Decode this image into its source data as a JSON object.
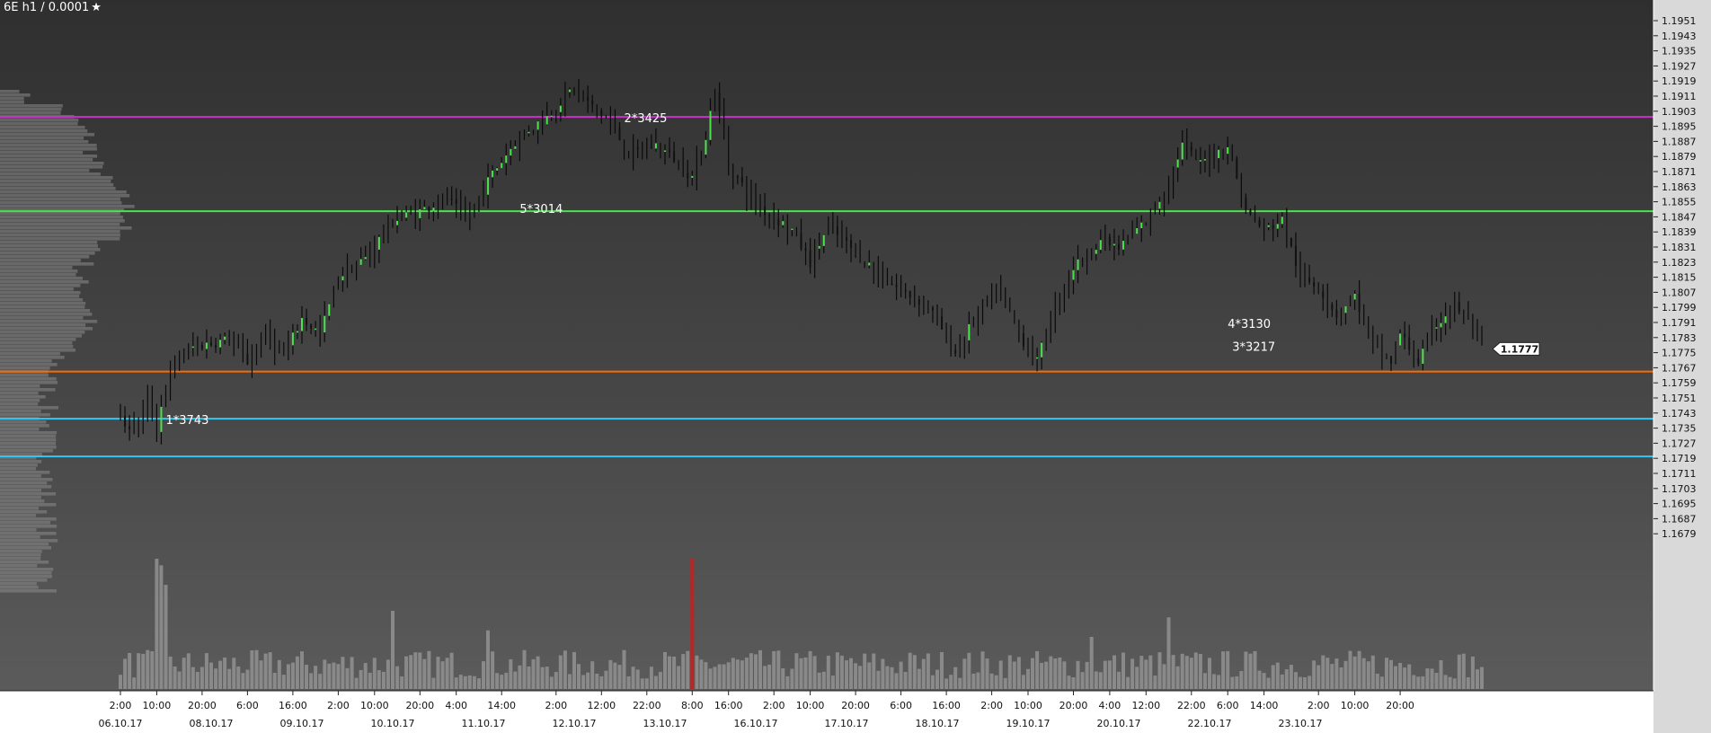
{
  "title": "6E h1 / 0.0001",
  "title_icon": "star-icon",
  "colors": {
    "magenta": "#c832c8",
    "green": "#4ce24c",
    "orange": "#ff6a00",
    "cyan": "#35c8f0",
    "red_spike": "#c81e1e"
  },
  "price_axis": {
    "min": 1.1675,
    "max": 1.1955,
    "ticks": [
      "1.1951",
      "1.1943",
      "1.1935",
      "1.1927",
      "1.1919",
      "1.1911",
      "1.1903",
      "1.1895",
      "1.1887",
      "1.1879",
      "1.1871",
      "1.1863",
      "1.1855",
      "1.1847",
      "1.1839",
      "1.1831",
      "1.1823",
      "1.1815",
      "1.1807",
      "1.1799",
      "1.1791",
      "1.1783",
      "1.1775",
      "1.1767",
      "1.1759",
      "1.1751",
      "1.1743",
      "1.1735",
      "1.1727",
      "1.1719",
      "1.1711",
      "1.1703",
      "1.1695",
      "1.1687",
      "1.1679"
    ]
  },
  "levels": [
    {
      "price": 1.19,
      "label": "1.1900",
      "color": "#c832c8"
    },
    {
      "price": 1.185,
      "label": "1.1850",
      "color": "#4ce24c"
    },
    {
      "price": 1.1765,
      "label": "1.1765",
      "color": "#ff6a00"
    },
    {
      "price": 1.174,
      "label": "1.1740",
      "color": "#35c8f0"
    },
    {
      "price": 1.172,
      "label": "1.1720",
      "color": "#35c8f0"
    }
  ],
  "current_price": {
    "price": 1.1777,
    "label": "1.1777"
  },
  "annotations": [
    {
      "text": "1*3743",
      "bar": 10,
      "price": 1.1739
    },
    {
      "text": "2*3425",
      "bar": 111,
      "price": 1.1899
    },
    {
      "text": "5*3014",
      "bar": 88,
      "price": 1.1851
    },
    {
      "text": "4*3130",
      "bar": 244,
      "price": 1.179
    },
    {
      "text": "3*3217",
      "bar": 245,
      "price": 1.1778
    }
  ],
  "time_axis": {
    "times": [
      {
        "label": "2:00",
        "bar": 0
      },
      {
        "label": "10:00",
        "bar": 8
      },
      {
        "label": "20:00",
        "bar": 18
      },
      {
        "label": "6:00",
        "bar": 28
      },
      {
        "label": "16:00",
        "bar": 38
      },
      {
        "label": "2:00",
        "bar": 48
      },
      {
        "label": "10:00",
        "bar": 56
      },
      {
        "label": "20:00",
        "bar": 66
      },
      {
        "label": "4:00",
        "bar": 74
      },
      {
        "label": "14:00",
        "bar": 84
      },
      {
        "label": "2:00",
        "bar": 96
      },
      {
        "label": "12:00",
        "bar": 106
      },
      {
        "label": "22:00",
        "bar": 116
      },
      {
        "label": "8:00",
        "bar": 126
      },
      {
        "label": "16:00",
        "bar": 134
      },
      {
        "label": "2:00",
        "bar": 144
      },
      {
        "label": "10:00",
        "bar": 152
      },
      {
        "label": "20:00",
        "bar": 162
      },
      {
        "label": "6:00",
        "bar": 172
      },
      {
        "label": "16:00",
        "bar": 182
      },
      {
        "label": "2:00",
        "bar": 192
      },
      {
        "label": "10:00",
        "bar": 200
      },
      {
        "label": "20:00",
        "bar": 210
      },
      {
        "label": "4:00",
        "bar": 218
      },
      {
        "label": "12:00",
        "bar": 226
      },
      {
        "label": "22:00",
        "bar": 236
      },
      {
        "label": "6:00",
        "bar": 244
      },
      {
        "label": "14:00",
        "bar": 252
      },
      {
        "label": "2:00",
        "bar": 264
      },
      {
        "label": "10:00",
        "bar": 272
      },
      {
        "label": "20:00",
        "bar": 282
      }
    ],
    "dates": [
      {
        "label": "06.10.17",
        "bar": 0
      },
      {
        "label": "08.10.17",
        "bar": 20
      },
      {
        "label": "09.10.17",
        "bar": 40
      },
      {
        "label": "10.10.17",
        "bar": 60
      },
      {
        "label": "11.10.17",
        "bar": 80
      },
      {
        "label": "12.10.17",
        "bar": 100
      },
      {
        "label": "13.10.17",
        "bar": 120
      },
      {
        "label": "16.10.17",
        "bar": 140
      },
      {
        "label": "17.10.17",
        "bar": 160
      },
      {
        "label": "18.10.17",
        "bar": 180
      },
      {
        "label": "19.10.17",
        "bar": 200
      },
      {
        "label": "20.10.17",
        "bar": 220
      },
      {
        "label": "22.10.17",
        "bar": 240
      },
      {
        "label": "23.10.17",
        "bar": 260
      }
    ]
  },
  "chart_data": {
    "type": "candlestick",
    "x_start_label": "06.10.17 2:00",
    "bar_interval": "1 hour",
    "anchors": [
      [
        0,
        1.1739
      ],
      [
        3,
        1.1735
      ],
      [
        6,
        1.175
      ],
      [
        8,
        1.1735
      ],
      [
        10,
        1.1758
      ],
      [
        12,
        1.177
      ],
      [
        16,
        1.1778
      ],
      [
        24,
        1.1782
      ],
      [
        28,
        1.177
      ],
      [
        32,
        1.1785
      ],
      [
        36,
        1.1773
      ],
      [
        40,
        1.1793
      ],
      [
        44,
        1.1785
      ],
      [
        48,
        1.1815
      ],
      [
        54,
        1.1825
      ],
      [
        60,
        1.1845
      ],
      [
        66,
        1.185
      ],
      [
        72,
        1.1857
      ],
      [
        76,
        1.1845
      ],
      [
        82,
        1.187
      ],
      [
        88,
        1.189
      ],
      [
        94,
        1.19
      ],
      [
        100,
        1.1916
      ],
      [
        104,
        1.1905
      ],
      [
        108,
        1.1897
      ],
      [
        112,
        1.188
      ],
      [
        118,
        1.1885
      ],
      [
        122,
        1.1878
      ],
      [
        126,
        1.1868
      ],
      [
        129,
        1.189
      ],
      [
        131,
        1.1915
      ],
      [
        134,
        1.1875
      ],
      [
        138,
        1.186
      ],
      [
        142,
        1.185
      ],
      [
        148,
        1.184
      ],
      [
        152,
        1.1823
      ],
      [
        156,
        1.1842
      ],
      [
        162,
        1.1828
      ],
      [
        168,
        1.1815
      ],
      [
        172,
        1.1808
      ],
      [
        178,
        1.18
      ],
      [
        184,
        1.1775
      ],
      [
        190,
        1.18
      ],
      [
        194,
        1.1808
      ],
      [
        198,
        1.1785
      ],
      [
        202,
        1.177
      ],
      [
        206,
        1.18
      ],
      [
        210,
        1.182
      ],
      [
        216,
        1.1835
      ],
      [
        220,
        1.183
      ],
      [
        226,
        1.1845
      ],
      [
        230,
        1.186
      ],
      [
        234,
        1.1885
      ],
      [
        238,
        1.1875
      ],
      [
        244,
        1.1885
      ],
      [
        248,
        1.185
      ],
      [
        252,
        1.184
      ],
      [
        256,
        1.1845
      ],
      [
        260,
        1.1815
      ],
      [
        264,
        1.181
      ],
      [
        268,
        1.1795
      ],
      [
        272,
        1.1805
      ],
      [
        276,
        1.178
      ],
      [
        280,
        1.177
      ],
      [
        282,
        1.1785
      ],
      [
        286,
        1.177
      ],
      [
        290,
        1.179
      ],
      [
        294,
        1.18
      ],
      [
        298,
        1.179
      ],
      [
        300,
        1.1777
      ]
    ],
    "volume_peaks": [
      {
        "bar": 8,
        "value": 1.0
      },
      {
        "bar": 9,
        "value": 0.95
      },
      {
        "bar": 10,
        "value": 0.8
      },
      {
        "bar": 60,
        "value": 0.6
      },
      {
        "bar": 81,
        "value": 0.45
      },
      {
        "bar": 126,
        "value": 1.0
      },
      {
        "bar": 231,
        "value": 0.55
      },
      {
        "bar": 214,
        "value": 0.4
      }
    ],
    "red_spike_bar": 126,
    "volume_profile_peak_price": 1.185
  }
}
